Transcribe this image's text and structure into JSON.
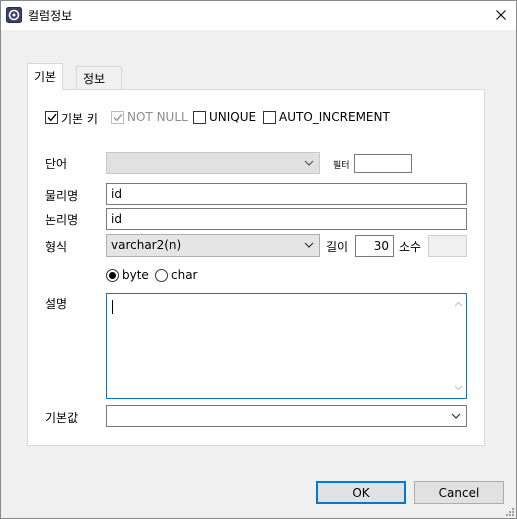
{
  "window": {
    "title": "컬럼정보"
  },
  "tabs": [
    {
      "label": "기본"
    },
    {
      "label": "정보"
    }
  ],
  "flags": {
    "primary_key": {
      "label": "기본 키",
      "checked": true
    },
    "not_null": {
      "label": "NOT NULL",
      "checked": true,
      "disabled": true
    },
    "unique": {
      "label": "UNIQUE",
      "checked": false
    },
    "auto_increment": {
      "label": "AUTO_INCREMENT",
      "checked": false
    }
  },
  "form": {
    "word_label": "단어",
    "word_value": "",
    "filter_label": "필터",
    "filter_value": "",
    "physical_name_label": "물리명",
    "physical_name_value": "id",
    "logical_name_label": "논리명",
    "logical_name_value": "id",
    "type_label": "형식",
    "type_value": "varchar2(n)",
    "length_label": "길이",
    "length_value": "30",
    "scale_label": "소수",
    "scale_value": "",
    "unit_options": [
      {
        "label": "byte",
        "selected": true
      },
      {
        "label": "char",
        "selected": false
      }
    ],
    "description_label": "설명",
    "description_value": "",
    "default_label": "기본값",
    "default_value": ""
  },
  "buttons": {
    "ok": "OK",
    "cancel": "Cancel"
  },
  "colors": {
    "focus_border": "#0078d7",
    "window_bg": "#f0f0f0"
  }
}
